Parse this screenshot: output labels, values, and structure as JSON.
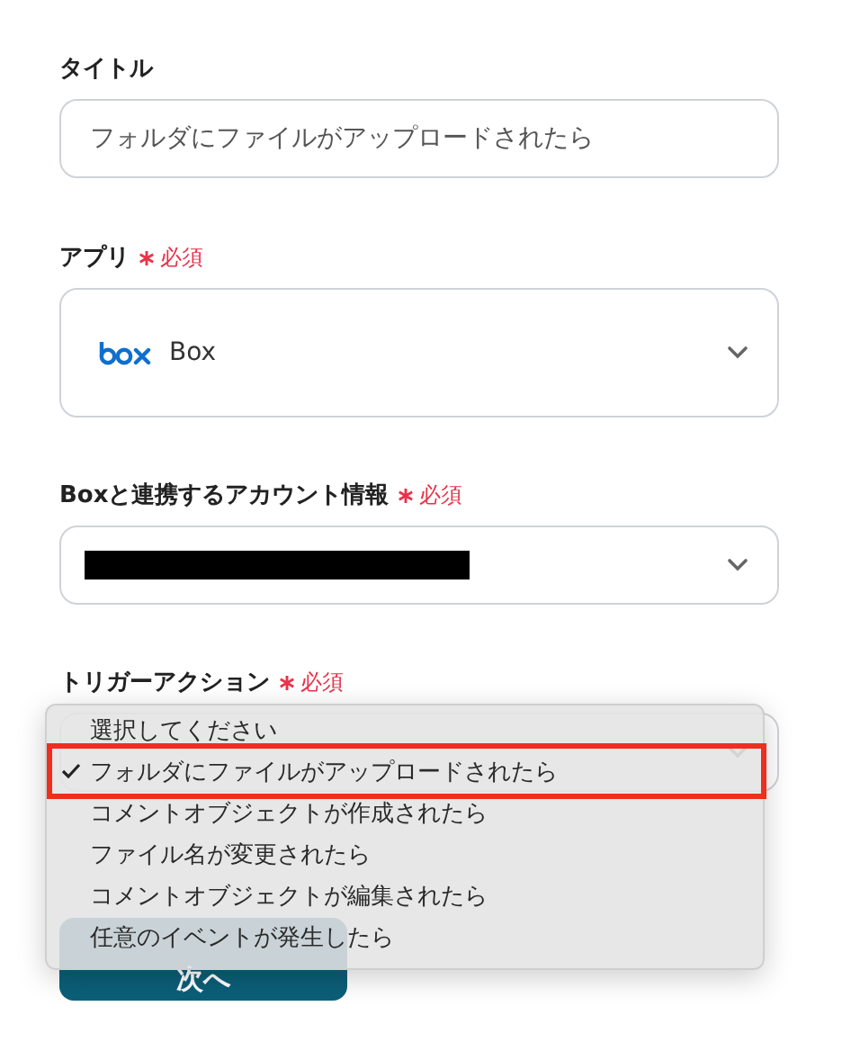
{
  "fields": [
    {
      "kind": "text",
      "label": "タイトル",
      "value": "フォルダにファイルがアップロードされたら"
    },
    {
      "kind": "app-select",
      "label": "アプリ",
      "required": "必須",
      "value": "Box"
    },
    {
      "kind": "redacted-select",
      "label": "Boxと連携するアカウント情報",
      "required": "必須"
    },
    {
      "kind": "menu-select",
      "label": "トリガーアクション",
      "required": "必須",
      "options": [
        {
          "label": "選択してください",
          "selected": false
        },
        {
          "label": "フォルダにファイルがアップロードされたら",
          "selected": true
        },
        {
          "label": "コメントオブジェクトが作成されたら",
          "selected": false
        },
        {
          "label": "ファイル名が変更されたら",
          "selected": false
        },
        {
          "label": "コメントオブジェクトが編集されたら",
          "selected": false
        },
        {
          "label": "任意のイベントが発生したら",
          "selected": false
        }
      ]
    }
  ],
  "next_button": "次へ"
}
